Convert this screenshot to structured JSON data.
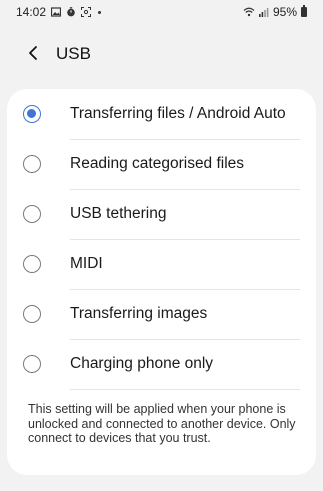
{
  "status_bar": {
    "time": "14:02",
    "battery": "95%",
    "icons": [
      "image-icon",
      "timer-icon",
      "screenshot-icon",
      "dot-icon",
      "wifi-icon",
      "signal-icon",
      "battery-icon"
    ]
  },
  "header": {
    "back_icon": "chevron-left-icon",
    "title": "USB"
  },
  "options": [
    {
      "label": "Transferring files / Android Auto",
      "selected": true
    },
    {
      "label": "Reading categorised files",
      "selected": false
    },
    {
      "label": "USB tethering",
      "selected": false
    },
    {
      "label": "MIDI",
      "selected": false
    },
    {
      "label": "Transferring images",
      "selected": false
    },
    {
      "label": "Charging phone only",
      "selected": false
    }
  ],
  "note": "This setting will be applied when your phone is unlocked and connected to another device. Only connect to devices that you trust.",
  "colors": {
    "accent": "#3e75d6",
    "background": "#f2f2f2",
    "card": "#ffffff"
  }
}
